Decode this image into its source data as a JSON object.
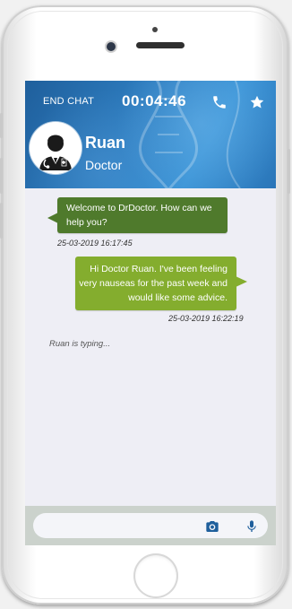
{
  "header": {
    "end_chat_label": "END CHAT",
    "timer": "00:04:46",
    "call_icon": "phone-icon",
    "favorite_icon": "star-icon"
  },
  "contact": {
    "name": "Ruan",
    "role": "Doctor",
    "avatar_icon": "doctor-avatar-icon"
  },
  "messages": [
    {
      "direction": "incoming",
      "text": "Welcome to DrDoctor. How can we help you?",
      "timestamp": "25-03-2019 16:17:45"
    },
    {
      "direction": "outgoing",
      "text": "Hi Doctor Ruan. I've been feeling very nauseas for the past week and would like some advice.",
      "timestamp": "25-03-2019 16:22:19"
    }
  ],
  "typing_indicator": "Ruan is typing...",
  "composer": {
    "value": "",
    "placeholder": "",
    "camera_icon": "camera-icon",
    "mic_icon": "microphone-icon"
  },
  "colors": {
    "header_blue": "#2f7fc2",
    "incoming_bubble": "#4f7a2c",
    "outgoing_bubble": "#84ad2e",
    "icon_blue": "#1f5f9c"
  }
}
